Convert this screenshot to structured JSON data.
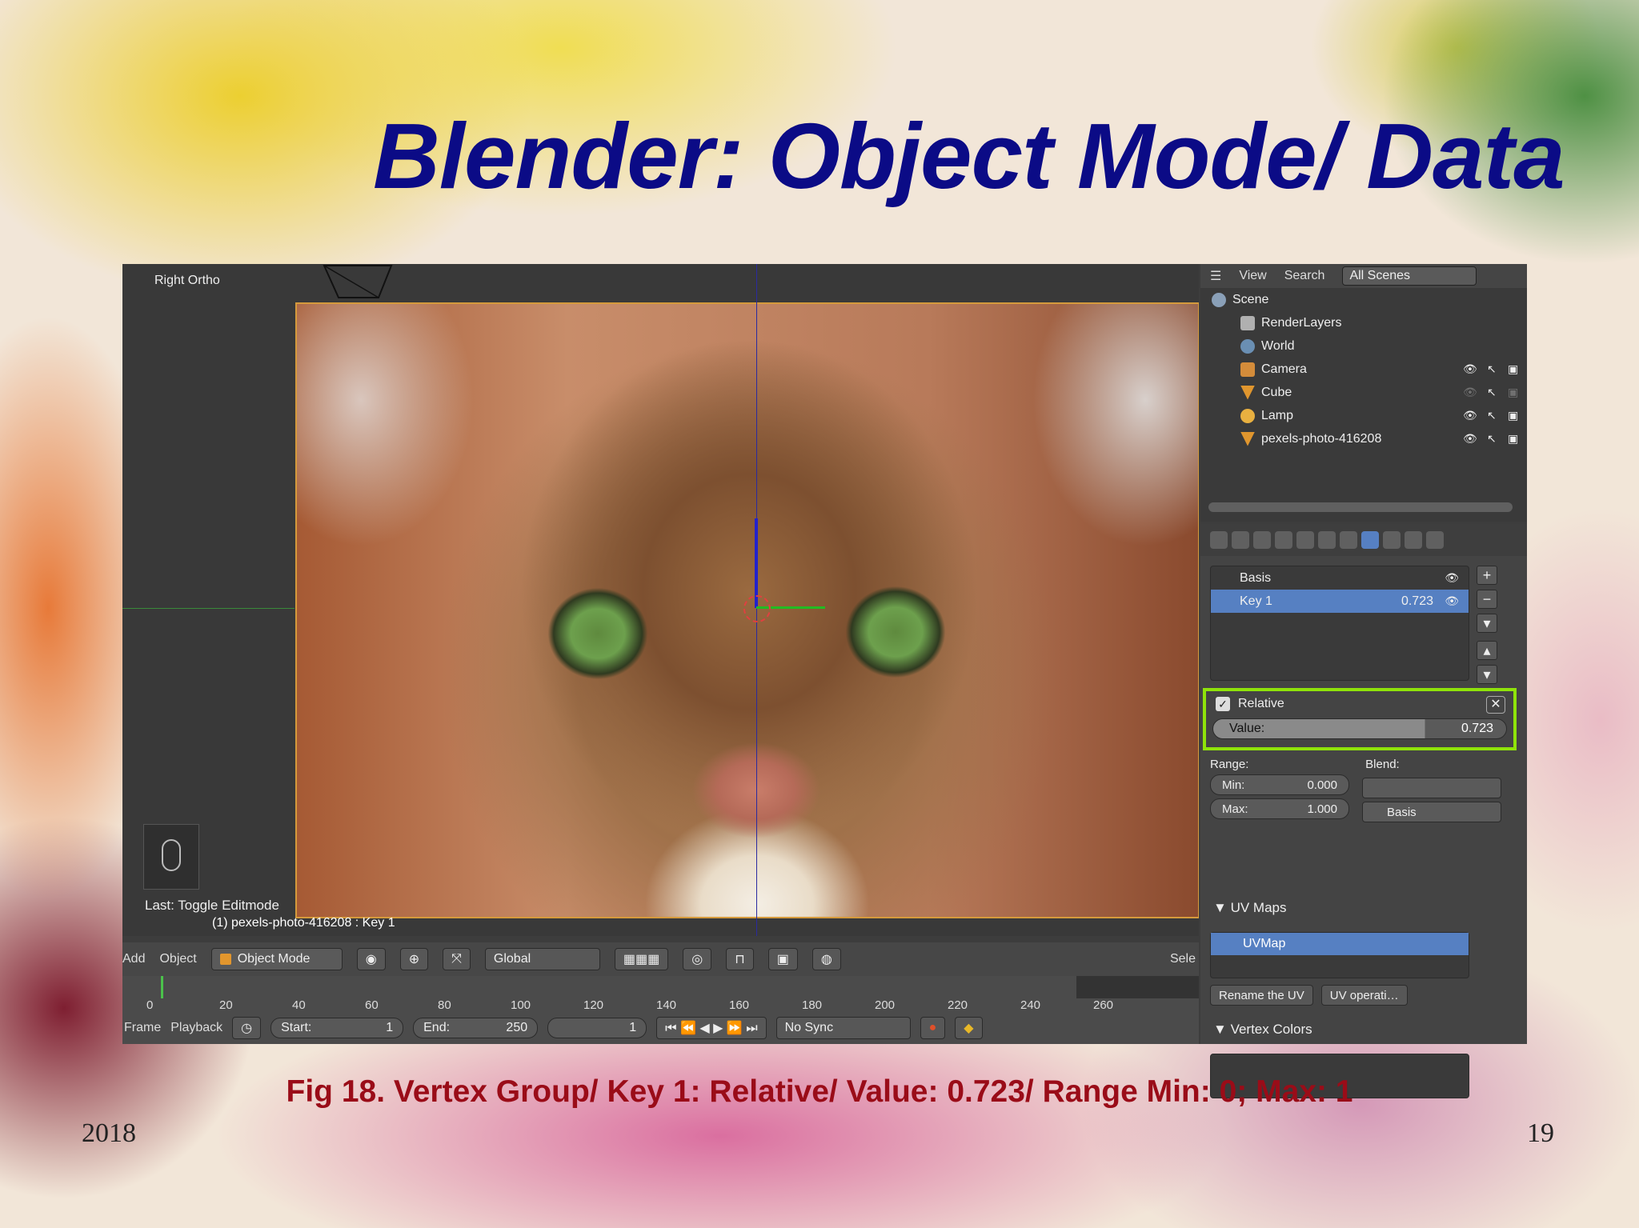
{
  "slide": {
    "title": "Blender: Object Mode/ Data",
    "caption": "Fig 18. Vertex Group/ Key 1: Relative/ Value: 0.723/ Range Min: 0; Max: 1",
    "year": "2018",
    "page": "19"
  },
  "viewport": {
    "view_label": "Right Ortho",
    "last_op": "Last: Toggle Editmode",
    "object_info": "(1) pexels-photo-416208 : Key 1"
  },
  "header": {
    "menu_add": "Add",
    "menu_object": "Object",
    "mode": "Object Mode",
    "orientation": "Global",
    "select_truncated": "Sele"
  },
  "timeline": {
    "ticks": [
      "0",
      "20",
      "40",
      "60",
      "80",
      "100",
      "120",
      "140",
      "160",
      "180",
      "200",
      "220",
      "240",
      "260"
    ],
    "menu_frame": "Frame",
    "menu_playback": "Playback",
    "start_label": "Start:",
    "start_value": "1",
    "end_label": "End:",
    "end_value": "250",
    "current_frame": "1",
    "sync": "No Sync"
  },
  "outliner": {
    "view": "View",
    "search": "Search",
    "scenes": "All Scenes",
    "items": [
      {
        "label": "Scene"
      },
      {
        "label": "RenderLayers"
      },
      {
        "label": "World"
      },
      {
        "label": "Camera"
      },
      {
        "label": "Cube"
      },
      {
        "label": "Lamp"
      },
      {
        "label": "pexels-photo-416208"
      }
    ]
  },
  "properties": {
    "shape_keys": [
      {
        "name": "Basis",
        "value": ""
      },
      {
        "name": "Key 1",
        "value": "0.723"
      }
    ],
    "relative_label": "Relative",
    "value_label": "Value:",
    "value": "0.723",
    "value_fraction": 0.723,
    "range_label": "Range:",
    "blend_label": "Blend:",
    "min_label": "Min:",
    "min_value": "0.000",
    "max_label": "Max:",
    "max_value": "1.000",
    "blend_basis": "Basis",
    "uv_maps_title": "UV Maps",
    "uv_map_name": "UVMap",
    "rename_uv": "Rename the UV",
    "uv_ops": "UV operati…",
    "vertex_colors_title": "Vertex Colors"
  },
  "colors": {
    "title": "#0b0b86",
    "caption": "#9a0c18",
    "highlight": "#8fe30a",
    "selection": "#5680c2"
  }
}
